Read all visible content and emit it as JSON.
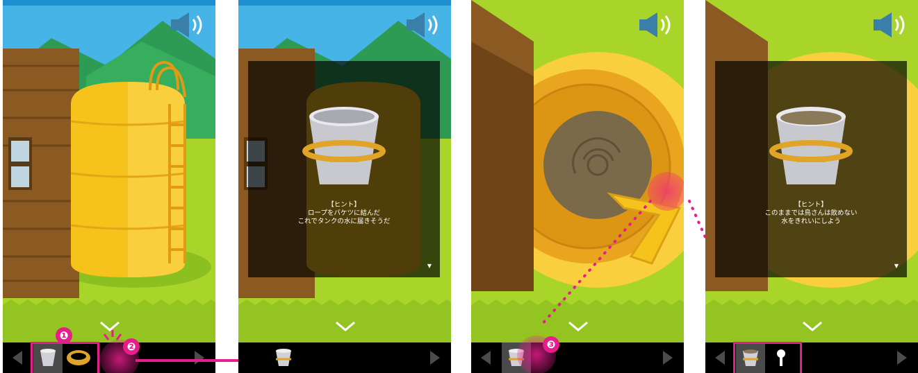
{
  "panels": [
    {
      "id": "tank-exterior",
      "items": [
        "bucket",
        "rope"
      ]
    },
    {
      "id": "hint-rope-bucket",
      "items": [
        "bucket-with-rope"
      ],
      "hint": {
        "title": "【ヒント】",
        "line1": "ロープをバケツに結んだ",
        "line2": "これでタンクの水に届きそうだ",
        "more": "▼"
      }
    },
    {
      "id": "tank-top-view",
      "items": [
        "bucket-with-rope"
      ]
    },
    {
      "id": "hint-water",
      "items": [
        "bucket-with-water",
        "key"
      ],
      "hint": {
        "title": "【ヒント】",
        "line1": "このままでは鳥さんは飲めない",
        "line2": "水をきれいにしよう",
        "more": "▼"
      }
    }
  ],
  "steps": {
    "one": "❶",
    "two": "❷",
    "three": "❸"
  },
  "icons": {
    "speaker": "speaker-icon",
    "chevron": "chevron-down-icon",
    "prev": "prev-arrow-icon",
    "next": "next-arrow-icon"
  },
  "colors": {
    "highlight": "#e61e8c",
    "tank": "#f6c21c",
    "grass": "#a9d52b",
    "sky": "#46b4e6",
    "wood": "#8a5a22",
    "bar": "#000000"
  }
}
